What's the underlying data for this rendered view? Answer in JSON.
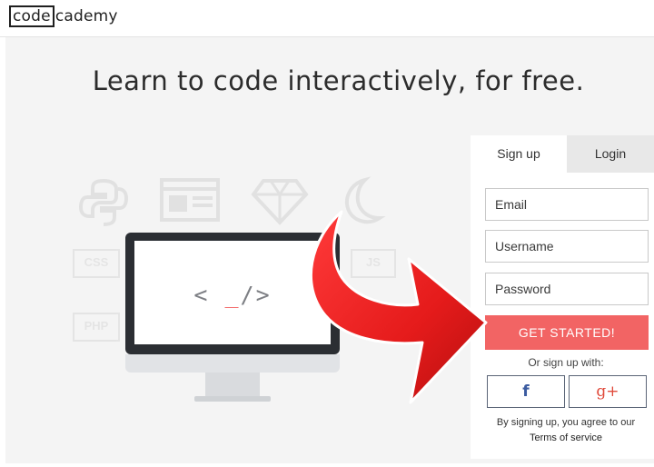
{
  "header": {
    "logo_code": "code",
    "logo_rest": "cademy"
  },
  "hero": {
    "headline": "Learn to code interactively, for free.",
    "code_glyph_left": "<",
    "code_glyph_cursor": "_",
    "code_glyph_right": "/>",
    "faded_tags": [
      "CSS",
      "JS",
      "PHP"
    ]
  },
  "form": {
    "tabs": [
      {
        "label": "Sign up",
        "active": true
      },
      {
        "label": "Login",
        "active": false
      }
    ],
    "email_placeholder": "Email",
    "username_placeholder": "Username",
    "password_placeholder": "Password",
    "submit_label": "GET STARTED!",
    "or_text": "Or sign up with:",
    "facebook_label": "f",
    "google_label": "g+",
    "terms_text": "By signing up, you agree to our",
    "terms_link": "Terms of service"
  },
  "colors": {
    "accent": "#f26464",
    "arrow": "#e51b1b",
    "facebook": "#3b5ba0",
    "google": "#e04b3c"
  },
  "icons": [
    "python-icon",
    "browser-window-icon",
    "diamond-icon",
    "moon-icon",
    "desktop-monitor-icon",
    "facebook-icon",
    "google-plus-icon",
    "red-curved-arrow"
  ]
}
